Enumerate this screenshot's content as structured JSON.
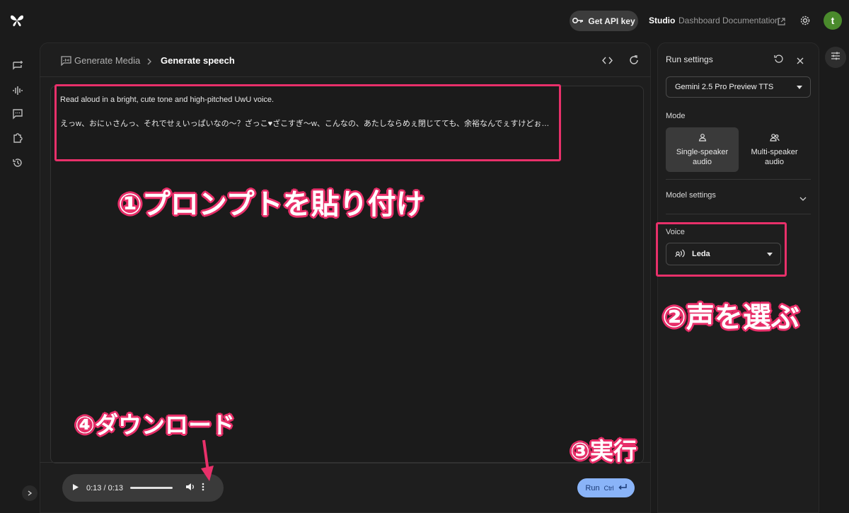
{
  "topbar": {
    "api_key_label": "Get API key",
    "nav": [
      "Studio",
      "Dashboard",
      "Documentation"
    ],
    "avatar_letter": "t"
  },
  "header": {
    "breadcrumb_parent": "Generate Media",
    "breadcrumb_current": "Generate speech"
  },
  "prompt": {
    "line1": "Read aloud in a bright, cute tone and high-pitched UwU voice.",
    "line2": "えっw、おにぃさんっ、それでせぇいっぱいなの〜？ざっこ♥ざこすぎ〜w、こんなの、あたしならめぇ閉じてても、余裕なんでぇすけどぉ…"
  },
  "player": {
    "time": "0:13 / 0:13"
  },
  "run": {
    "label": "Run",
    "shortcut": "Ctrl"
  },
  "settings": {
    "title": "Run settings",
    "model": "Gemini 2.5 Pro Preview TTS",
    "mode_label": "Mode",
    "mode_single": "Single-speaker audio",
    "mode_multi": "Multi-speaker audio",
    "model_settings_label": "Model settings",
    "voice_label": "Voice",
    "voice_value": "Leda"
  },
  "annotations": {
    "step1": "①プロンプトを貼り付け",
    "step2": "②声を選ぶ",
    "step3": "③実行",
    "step4": "④ダウンロード"
  },
  "colors": {
    "accent": "#8ab4f8",
    "highlight": "#e8306a",
    "avatar": "#4a8a2c"
  }
}
